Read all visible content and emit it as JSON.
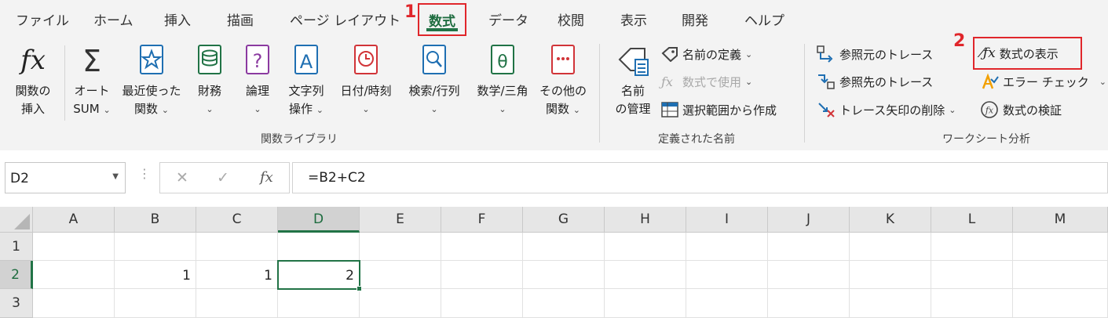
{
  "colors": {
    "accent": "#217346",
    "callout": "#e0262b",
    "ribbon_bg": "#f3f3f3"
  },
  "tabs": {
    "file": "ファイル",
    "home": "ホーム",
    "insert": "挿入",
    "draw": "描画",
    "page_layout": "ページ レイアウト",
    "formulas": "数式",
    "data": "データ",
    "review": "校閲",
    "view": "表示",
    "developer": "開発",
    "help": "ヘルプ"
  },
  "callouts": {
    "one": "1",
    "two": "2"
  },
  "function_library": {
    "insert_function": {
      "line1": "関数の",
      "line2": "挿入",
      "icon": "fx-icon"
    },
    "autosum": {
      "line1": "オート",
      "line2": "SUM",
      "icon": "sigma-icon"
    },
    "recent": {
      "line1": "最近使った",
      "line2": "関数",
      "icon": "star-book-icon"
    },
    "financial": {
      "line1": "財務",
      "icon": "coins-book-icon"
    },
    "logical": {
      "line1": "論理",
      "icon": "question-book-icon"
    },
    "text": {
      "line1": "文字列",
      "line2": "操作",
      "icon": "letter-book-icon"
    },
    "datetime": {
      "line1": "日付/時刻",
      "icon": "clock-book-icon"
    },
    "lookup": {
      "line1": "検索/行列",
      "icon": "magnifier-book-icon"
    },
    "math": {
      "line1": "数学/三角",
      "icon": "theta-book-icon"
    },
    "more": {
      "line1": "その他の",
      "line2": "関数",
      "icon": "dots-book-icon"
    },
    "group_label": "関数ライブラリ"
  },
  "defined_names": {
    "name_manager": {
      "line1": "名前",
      "line2": "の管理",
      "icon": "name-tag-icon"
    },
    "define_name": "名前の定義",
    "use_in_formula": "数式で使用",
    "create_from_selection": "選択範囲から作成",
    "group_label": "定義された名前"
  },
  "formula_auditing": {
    "trace_precedents": "参照元のトレース",
    "trace_dependents": "参照先のトレース",
    "remove_arrows": "トレース矢印の削除",
    "show_formulas": "数式の表示",
    "error_checking": "エラー チェック",
    "evaluate_formula": "数式の検証",
    "group_label": "ワークシート分析"
  },
  "formula_bar": {
    "name_box": "D2",
    "formula": "=B2+C2",
    "fx": "fx",
    "cancel": "✕",
    "enter": "✓"
  },
  "grid": {
    "columns": [
      "A",
      "B",
      "C",
      "D",
      "E",
      "F",
      "G",
      "H",
      "I",
      "J",
      "K",
      "L",
      "M"
    ],
    "rows": [
      "1",
      "2",
      "3"
    ],
    "cells": {
      "B2": "1",
      "C2": "1",
      "D2": "2"
    }
  }
}
